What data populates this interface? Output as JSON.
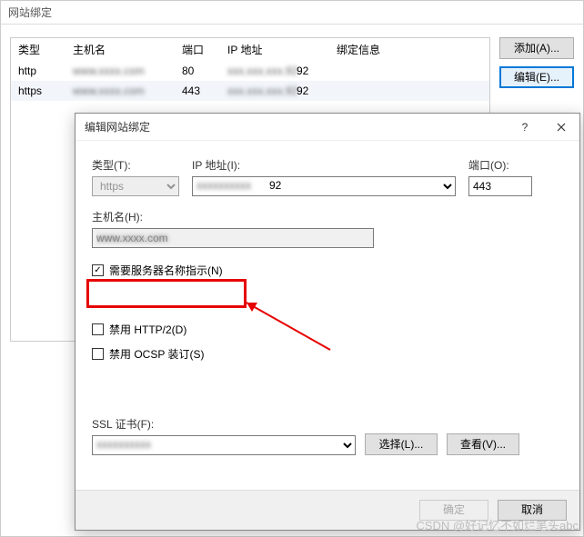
{
  "main": {
    "title": "网站绑定",
    "columns": [
      "类型",
      "主机名",
      "端口",
      "IP 地址",
      "绑定信息"
    ],
    "rows": [
      {
        "type": "http",
        "host": "www.xxxx.com",
        "port": "80",
        "ip": "xxx.xxx.xxx.92",
        "info": ""
      },
      {
        "type": "https",
        "host": "www.xxxx.com",
        "port": "443",
        "ip": "xxx.xxx.xxx.92",
        "info": ""
      }
    ],
    "buttons": {
      "add": "添加(A)...",
      "edit": "编辑(E)..."
    }
  },
  "dialog": {
    "title": "编辑网站绑定",
    "labels": {
      "type": "类型(T):",
      "ip": "IP 地址(I):",
      "port": "端口(O):",
      "host": "主机名(H):",
      "sni": "需要服务器名称指示(N)",
      "http2": "禁用 HTTP/2(D)",
      "ocsp": "禁用 OCSP 装订(S)",
      "ssl": "SSL 证书(F):",
      "select": "选择(L)...",
      "view": "查看(V)...",
      "ok": "确定",
      "cancel": "取消"
    },
    "values": {
      "type": "https",
      "ip": "xxx.xxx.xxx.92",
      "port": "443",
      "host": "www.xxxx.com",
      "ssl": "xxxxxxxxxx"
    }
  },
  "watermark": "CSDN @好记忆不如烂笔头abc"
}
